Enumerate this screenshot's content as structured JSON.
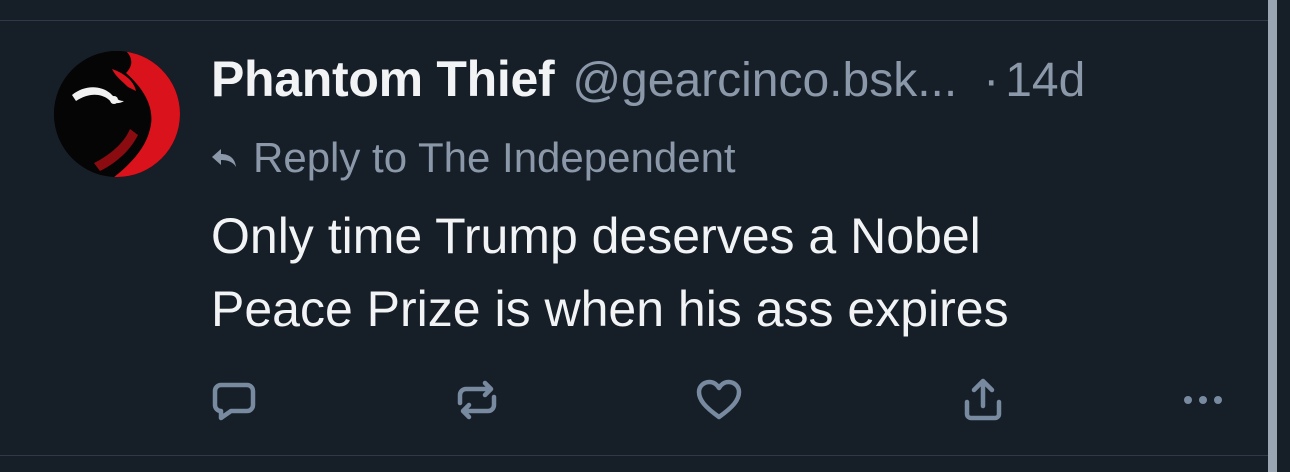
{
  "post": {
    "author": {
      "display_name": "Phantom Thief",
      "handle": "@gearcinco.bsk..."
    },
    "separator": "·",
    "timestamp": "14d",
    "reply_to": "Reply to The Independent",
    "text_lines": [
      "Only time Trump deserves a Nobel",
      "Peace Prize is when his ass expires"
    ]
  },
  "actions": [
    {
      "icon": "comment-icon"
    },
    {
      "icon": "repost-icon"
    },
    {
      "icon": "heart-icon"
    },
    {
      "icon": "share-icon"
    },
    {
      "icon": "more-icon"
    }
  ],
  "colors": {
    "background": "#161e27",
    "primary_text": "#f1f3f5",
    "secondary_text": "#8b98a9",
    "icon": "#788aa0",
    "avatar_red": "#d9121c"
  }
}
